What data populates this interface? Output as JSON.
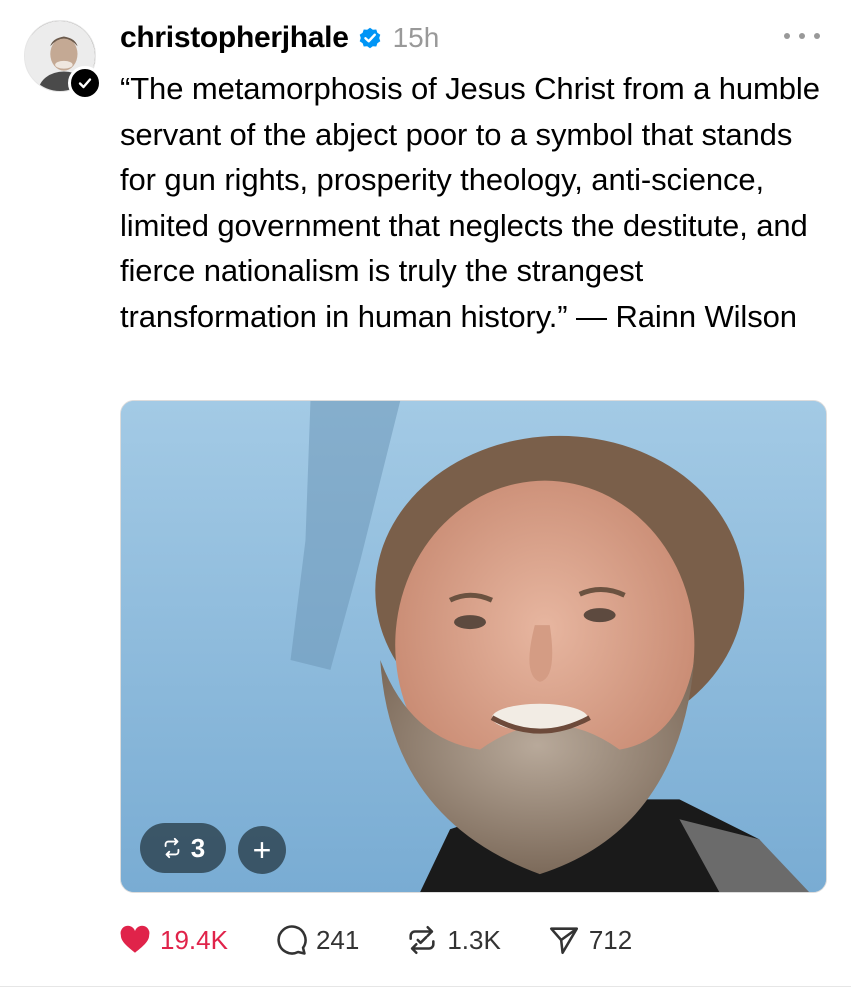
{
  "post": {
    "username": "christopherjhale",
    "timestamp": "15h",
    "text": "“The metamorphosis of Jesus Christ from a humble servant of the abject poor to a symbol that stands for gun rights, prosperity theology, anti-science, limited government that neglects the destitute, and fierce nationalism is truly the strangest transformation in human history.” — Rainn Wilson",
    "verified": true,
    "photo_overlay": {
      "repost_count": "3",
      "add_label": "+"
    }
  },
  "actions": {
    "likes": "19.4K",
    "replies": "241",
    "reposts": "1.3K",
    "shares": "712",
    "liked": true
  },
  "colors": {
    "like": "#e0234a",
    "verified": "#0095f6",
    "muted_text": "#999999",
    "photo_bg": "#8ebcdd"
  },
  "icons": {
    "verified": "verified-badge-icon",
    "more": "more-horizontal-icon",
    "like": "heart-filled-icon",
    "reply": "comment-bubble-icon",
    "repost": "repost-icon",
    "share": "send-icon",
    "add": "plus-icon"
  }
}
